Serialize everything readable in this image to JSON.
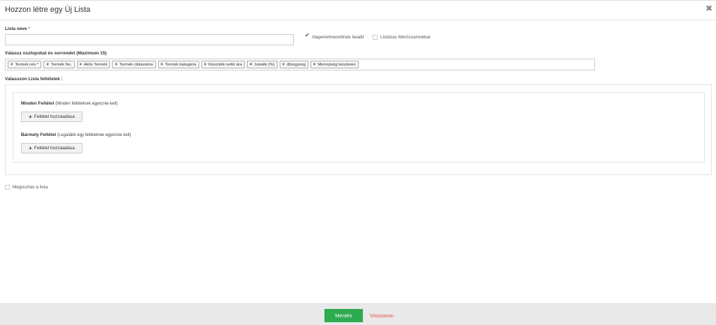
{
  "modal": {
    "title": "Hozzon létre egy Új Lista",
    "close_glyph": "✖"
  },
  "form": {
    "name_label": "Lista neve",
    "required_mark": "*",
    "name_value": "",
    "name_placeholder": "",
    "default_checkbox_label": "Alapertelmezettnek beallit",
    "default_checked": true,
    "meters_checkbox_label": "Listázas Meröszamokkal",
    "meters_checked": false,
    "columns_label": "Válassz oszlopokat és sorrendet (Maximum 15)",
    "columns": [
      "Termék név *",
      "Termék No.",
      "Aktív Termék",
      "Termék cikkszáma",
      "Termék kategória",
      "Készülék nettó ára",
      "Jutalék (%)",
      "db/egység",
      "Mennyiség készleten"
    ],
    "conditions_label": "Válasszon Lista feltételek :",
    "all_conditions": {
      "title": "Minden Feltétel",
      "subtitle": "(Minden feltételnek egyeznie kell)",
      "button": "Feltétel hozzáadása"
    },
    "any_conditions": {
      "title": "Bármely Feltétel",
      "subtitle": "(Legalább egy feltételnek egyeznie kell)",
      "button": "Feltétel hozzáadása"
    },
    "share_checkbox_label": "Megosztas a lista",
    "share_checked": false
  },
  "footer": {
    "save_label": "Mentés",
    "cancel_label": "Visszavon"
  },
  "colors": {
    "save_button": "#2eaa4f",
    "cancel_link": "#e74c3c",
    "footer_bg": "#e9e9e9"
  },
  "icons": {
    "close": "close-icon",
    "tag_remove": "remove-x-icon",
    "add": "plus-icon",
    "check": "checkmark-icon"
  }
}
